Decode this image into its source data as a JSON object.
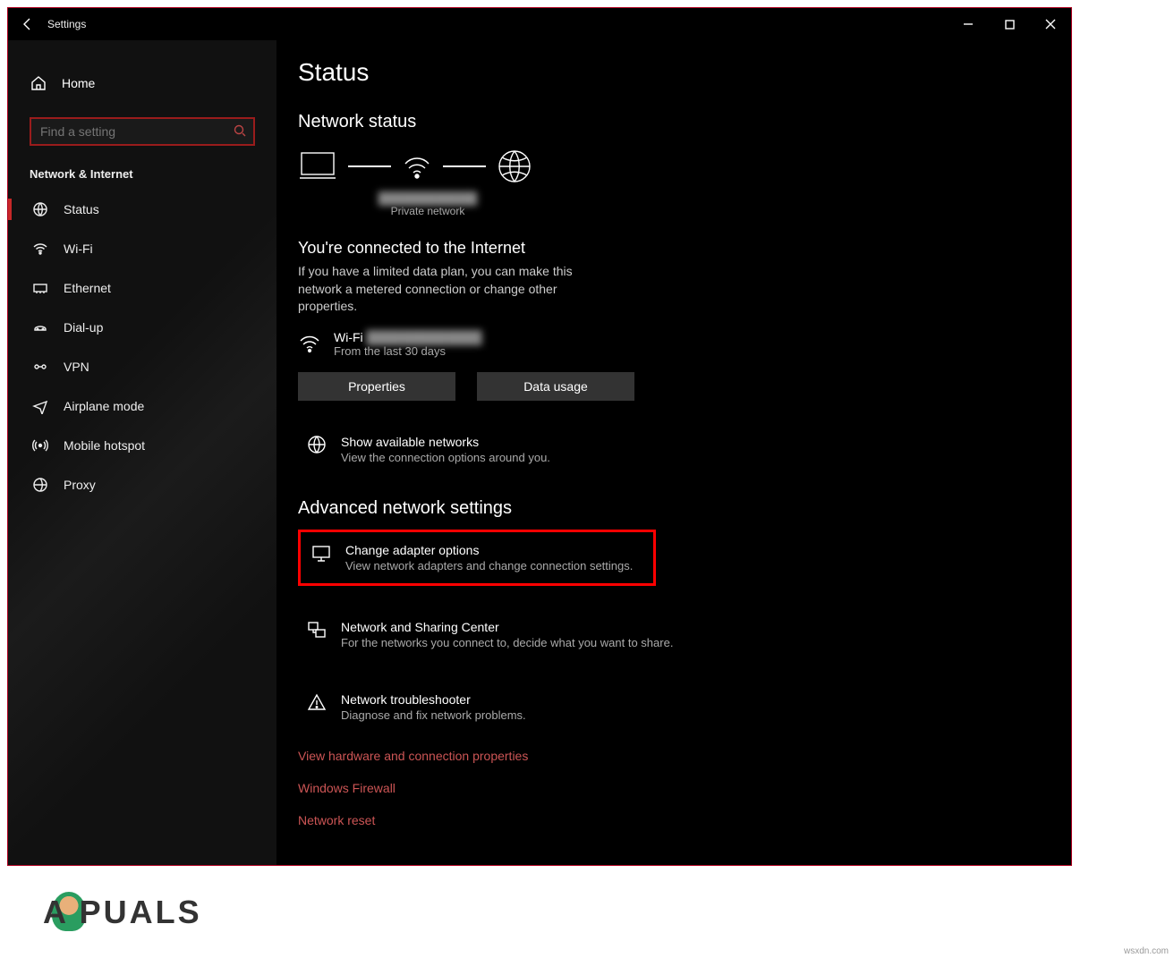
{
  "window": {
    "title": "Settings"
  },
  "sidebar": {
    "home": "Home",
    "search_placeholder": "Find a setting",
    "category": "Network & Internet",
    "items": [
      {
        "label": "Status",
        "active": true
      },
      {
        "label": "Wi-Fi"
      },
      {
        "label": "Ethernet"
      },
      {
        "label": "Dial-up"
      },
      {
        "label": "VPN"
      },
      {
        "label": "Airplane mode"
      },
      {
        "label": "Mobile hotspot"
      },
      {
        "label": "Proxy"
      }
    ]
  },
  "main": {
    "page_title": "Status",
    "network_status_header": "Network status",
    "network_label": "Private network",
    "connected_title": "You're connected to the Internet",
    "connected_desc": "If you have a limited data plan, you can make this network a metered connection or change other properties.",
    "wifi_name": "Wi-Fi",
    "wifi_sub": "From the last 30 days",
    "properties_btn": "Properties",
    "data_usage_btn": "Data usage",
    "show_networks_title": "Show available networks",
    "show_networks_desc": "View the connection options around you.",
    "advanced_header": "Advanced network settings",
    "change_adapter_title": "Change adapter options",
    "change_adapter_desc": "View network adapters and change connection settings.",
    "sharing_title": "Network and Sharing Center",
    "sharing_desc": "For the networks you connect to, decide what you want to share.",
    "troubleshooter_title": "Network troubleshooter",
    "troubleshooter_desc": "Diagnose and fix network problems.",
    "links": [
      "View hardware and connection properties",
      "Windows Firewall",
      "Network reset"
    ]
  },
  "watermark": "A  PUALS"
}
